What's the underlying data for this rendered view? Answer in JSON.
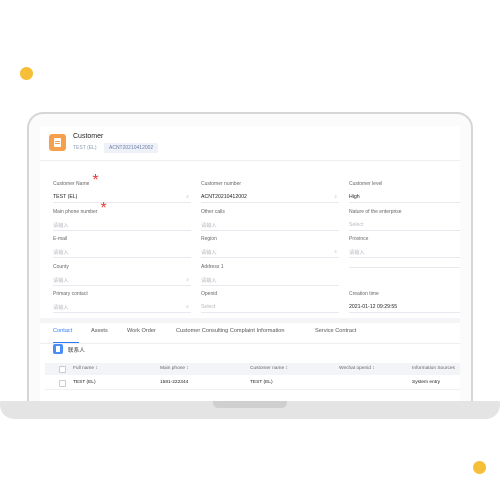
{
  "record": {
    "title": "Customer",
    "subtitle": "TEST (EL)",
    "number_tag": "ACNT20210412002"
  },
  "fields": [
    {
      "label": "Customer Name",
      "required": true,
      "value": "TEST (EL)",
      "placeholder": false,
      "icon": "search-icon"
    },
    {
      "label": "Customer number",
      "required": false,
      "value": "ACNT20210412002",
      "placeholder": false,
      "icon": "search-icon"
    },
    {
      "label": "Customer level",
      "required": false,
      "value": "High",
      "placeholder": false,
      "icon": ""
    },
    {
      "label": "Main phone number",
      "required": true,
      "value": "请输入",
      "placeholder": true,
      "icon": ""
    },
    {
      "label": "Other calls",
      "required": false,
      "value": "请输入",
      "placeholder": true,
      "icon": ""
    },
    {
      "label": "Nature of the enterprise",
      "required": false,
      "value": "Select",
      "placeholder": true,
      "icon": ""
    },
    {
      "label": "E-mail",
      "required": false,
      "value": "请输入",
      "placeholder": true,
      "icon": ""
    },
    {
      "label": "Region",
      "required": false,
      "value": "请输入",
      "placeholder": true,
      "icon": "search-icon"
    },
    {
      "label": "Province",
      "required": false,
      "value": "请输入",
      "placeholder": true,
      "icon": ""
    },
    {
      "label": "County",
      "required": false,
      "value": "请输入",
      "placeholder": true,
      "icon": "search-icon"
    },
    {
      "label": "Address 1",
      "required": false,
      "value": "请输入",
      "placeholder": true,
      "icon": ""
    },
    {
      "label": "",
      "required": false,
      "value": "",
      "placeholder": true,
      "icon": ""
    },
    {
      "label": "Primary contact",
      "required": false,
      "value": "请输入",
      "placeholder": true,
      "icon": "search-icon"
    },
    {
      "label": "Openid",
      "required": false,
      "value": "Select",
      "placeholder": true,
      "icon": ""
    },
    {
      "label": "Creation time",
      "required": false,
      "value": "2021-01-12 09:29:55",
      "placeholder": false,
      "icon": ""
    }
  ],
  "tabs": [
    "Contact",
    "Assets",
    "Work Order",
    "Customer Consulting Complaint Information",
    "Service Contract"
  ],
  "active_tab": "Contact",
  "subgrid": {
    "title": "联系人",
    "columns": [
      "Full name ↕",
      "Main phone ↕",
      "Customer name ↕",
      "Wechat openid ↕",
      "Information Sources"
    ],
    "rows": [
      [
        "TEST (EL)",
        "1581-222344",
        "TEST (EL)",
        "",
        "System entry"
      ]
    ]
  },
  "colors": {
    "accent": "#2f7cf6",
    "record_icon": "#f6a04d",
    "dots": "#f7be38",
    "required": "#e0413b"
  }
}
